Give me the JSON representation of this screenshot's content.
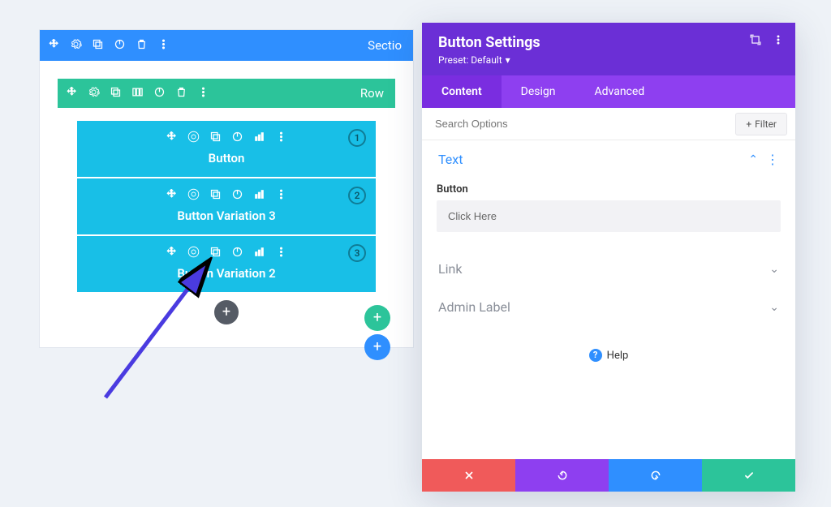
{
  "section": {
    "label": "Sectio"
  },
  "row": {
    "label": "Row"
  },
  "modules": [
    {
      "label": "Button",
      "badge": "1"
    },
    {
      "label": "Button Variation 3",
      "badge": "2"
    },
    {
      "label": "Button Variation 2",
      "badge": "3"
    }
  ],
  "modal": {
    "title": "Button Settings",
    "preset": "Preset: Default",
    "tabs": {
      "content": "Content",
      "design": "Design",
      "advanced": "Advanced"
    },
    "search_placeholder": "Search Options",
    "filter": "Filter",
    "panels": {
      "text": {
        "title": "Text",
        "field_label": "Button",
        "field_value": "Click Here"
      },
      "link": {
        "title": "Link"
      },
      "admin": {
        "title": "Admin Label"
      }
    },
    "help": "Help"
  }
}
